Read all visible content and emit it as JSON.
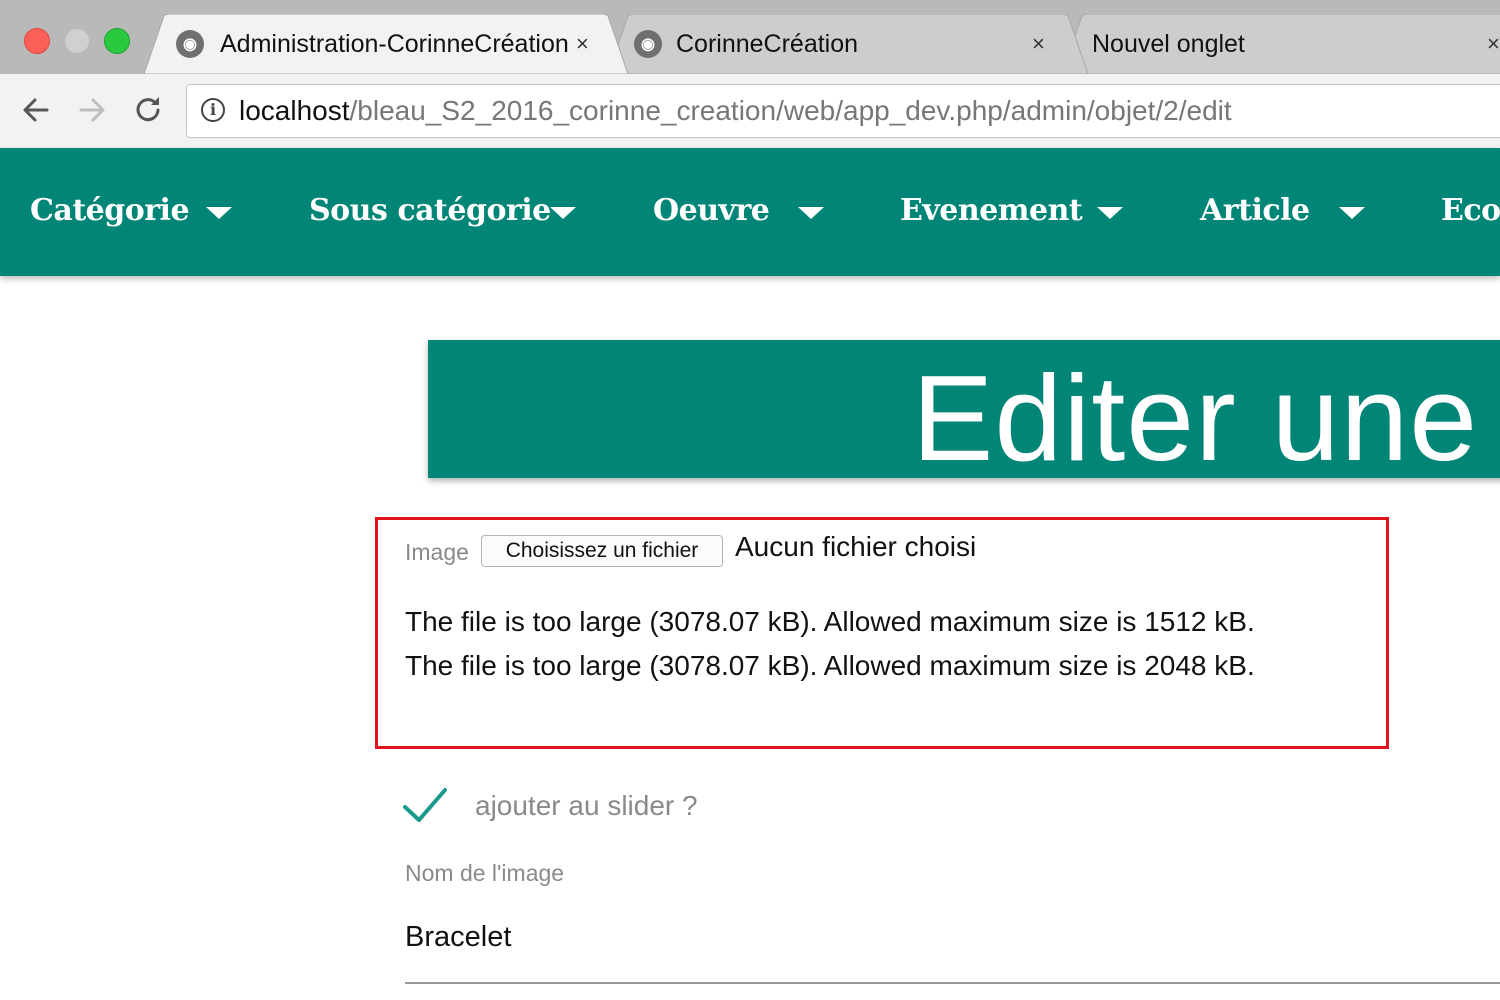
{
  "browser": {
    "tabs": [
      {
        "title": "Administration-CorinneCréation",
        "close": "×"
      },
      {
        "title": "CorinneCréation",
        "close": "×"
      },
      {
        "title": "Nouvel onglet",
        "close": "×"
      }
    ],
    "url_host": "localhost",
    "url_path": "/bleau_S2_2016_corinne_creation/web/app_dev.php/admin/objet/2/edit",
    "info_icon": "i"
  },
  "nav": {
    "items": [
      {
        "label": "Catégorie"
      },
      {
        "label": "Sous catégorie"
      },
      {
        "label": "Oeuvre"
      },
      {
        "label": "Evenement"
      },
      {
        "label": "Article"
      },
      {
        "label": "Ecole"
      }
    ]
  },
  "page": {
    "title": "Editer une"
  },
  "form": {
    "image_label": "Image",
    "file_button": "Choisissez un fichier",
    "file_status": "Aucun fichier choisi",
    "errors": [
      "The file is too large (3078.07 kB). Allowed maximum size is 1512 kB.",
      "The file is too large (3078.07 kB). Allowed maximum size is 2048 kB."
    ],
    "slider_label": "ajouter au slider ?",
    "slider_checked": true,
    "name_label": "Nom de l'image",
    "name_value": "Bracelet"
  },
  "colors": {
    "accent": "#008577",
    "error": "#e0141e"
  }
}
